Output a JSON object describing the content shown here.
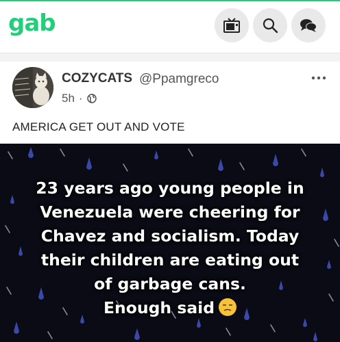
{
  "header": {
    "logo": "gab",
    "buttons": [
      "tv",
      "search",
      "chat"
    ]
  },
  "feed_remnant": "· · · · · · · ·",
  "post": {
    "author_name": "COZYCATS",
    "author_handle": "@Ppamgreco",
    "time": "5h",
    "separator": "·",
    "visibility_icon": "globe-icon",
    "text": "AMERICA GET OUT AND VOTE",
    "media": {
      "lines": [
        "23 years ago young people in",
        "Venezuela were cheering for",
        "Chavez and socialism. Today",
        "their children are eating out",
        "of garbage cans.",
        "Enough said"
      ],
      "emoji": "unamused-face"
    }
  },
  "colors": {
    "brand": "#21cf7a",
    "button_bg": "#e9e9e9",
    "media_bg": "#0a0b14",
    "raindrop": "#3a49a8"
  }
}
